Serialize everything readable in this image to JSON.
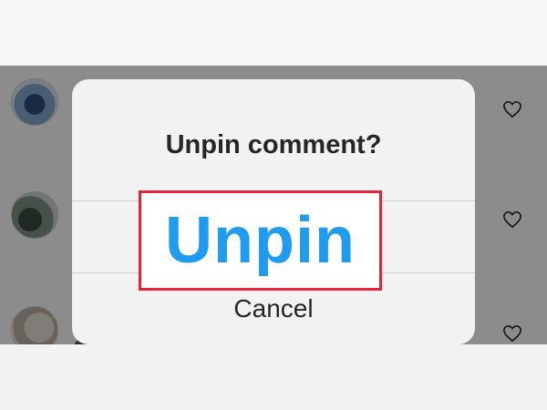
{
  "dialog": {
    "title": "Unpin comment?",
    "unpin_label": "Unpin",
    "cancel_label": "Cancel"
  },
  "icons": {
    "heart": "heart-icon"
  },
  "colors": {
    "unpin_text": "#1f9bf0",
    "highlight_border": "#e0243a",
    "dialog_bg": "#f2f2f2",
    "overlay": "rgba(0,0,0,0.45)"
  }
}
